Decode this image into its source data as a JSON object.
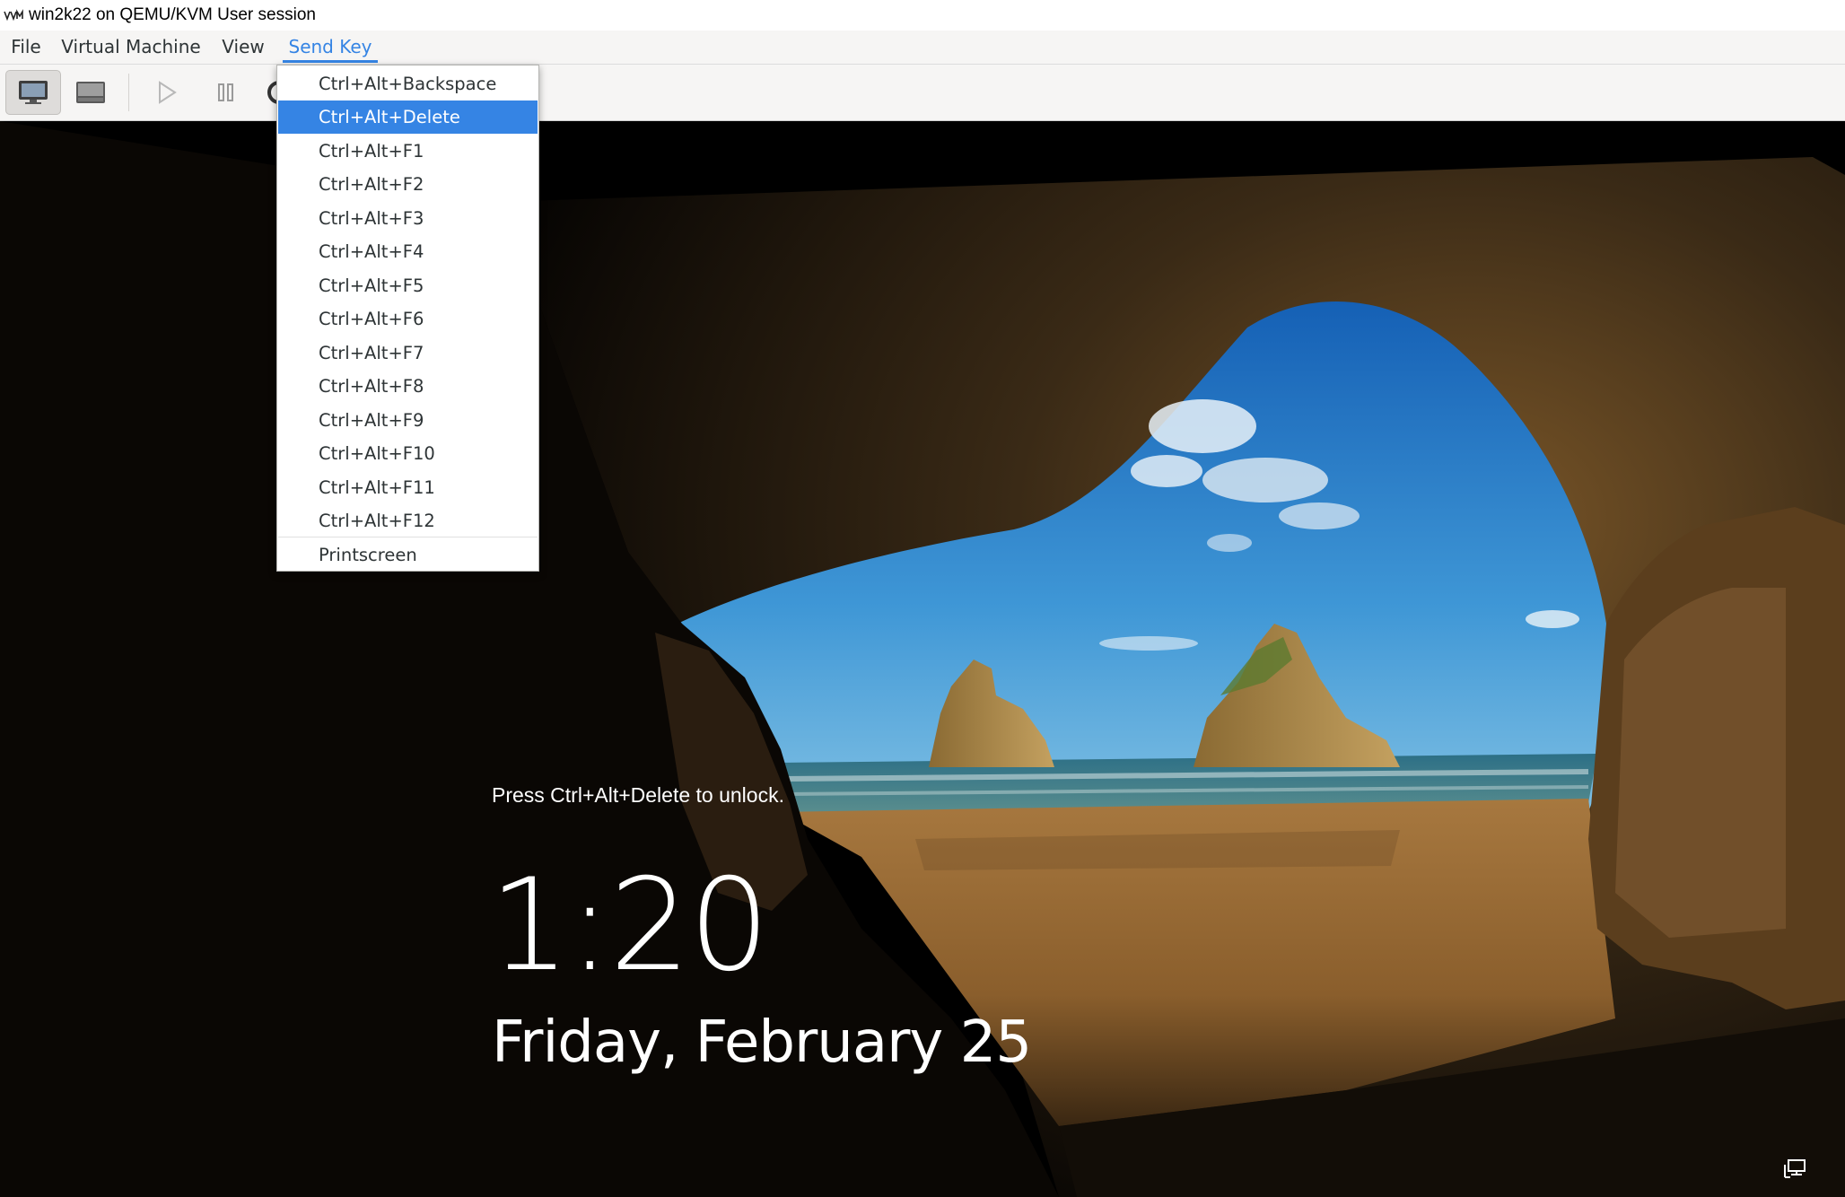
{
  "window": {
    "title": "win2k22 on QEMU/KVM User session",
    "app_icon": "virt-manager-icon"
  },
  "menubar": {
    "items": [
      {
        "label": "File"
      },
      {
        "label": "Virtual Machine"
      },
      {
        "label": "View"
      },
      {
        "label": "Send Key",
        "active": true
      }
    ]
  },
  "toolbar": {
    "buttons": [
      {
        "icon": "console-display-icon",
        "pressed": true
      },
      {
        "icon": "vm-details-icon",
        "pressed": false
      },
      {
        "icon": "run-icon",
        "pressed": false
      },
      {
        "icon": "pause-icon",
        "pressed": false
      },
      {
        "icon": "shutdown-icon",
        "pressed": false
      }
    ]
  },
  "send_key_menu": {
    "items": [
      {
        "label": "Ctrl+Alt+Backspace"
      },
      {
        "label": "Ctrl+Alt+Delete",
        "highlighted": true
      },
      {
        "label": "Ctrl+Alt+F1"
      },
      {
        "label": "Ctrl+Alt+F2"
      },
      {
        "label": "Ctrl+Alt+F3"
      },
      {
        "label": "Ctrl+Alt+F4"
      },
      {
        "label": "Ctrl+Alt+F5"
      },
      {
        "label": "Ctrl+Alt+F6"
      },
      {
        "label": "Ctrl+Alt+F7"
      },
      {
        "label": "Ctrl+Alt+F8"
      },
      {
        "label": "Ctrl+Alt+F9"
      },
      {
        "label": "Ctrl+Alt+F10"
      },
      {
        "label": "Ctrl+Alt+F11"
      },
      {
        "label": "Ctrl+Alt+F12"
      },
      {
        "label": "Printscreen"
      }
    ],
    "highlight_color": "#3584e4"
  },
  "lock_screen": {
    "hint": "Press Ctrl+Alt+Delete to unlock.",
    "time": "1:20",
    "date": "Friday, February 25",
    "status_icon": "network-icon"
  },
  "colors": {
    "accent": "#3584e4",
    "menubar_bg": "#f6f5f4",
    "console_bg": "#000000"
  }
}
